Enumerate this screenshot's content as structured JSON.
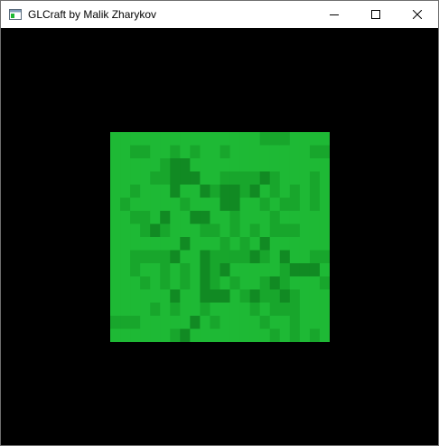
{
  "window": {
    "title": "GLCraft by Malik Zharykov",
    "app_icon": "application-window-icon",
    "controls": {
      "minimize": "minimize-icon",
      "maximize": "maximize-icon",
      "close": "close-icon"
    }
  },
  "scene": {
    "background_color": "#000000",
    "block": {
      "name": "grass block",
      "palette": {
        "0": "#1eb935",
        "1": "#18a62c",
        "2": "#118a23"
      },
      "grid": [
        "0000000000000001110000",
        "0011001010010000000011",
        "0000012200000000000000",
        "0000112220011112100010",
        "0010002002122120101010",
        "0100000100022001011010",
        "0011020022001000100000",
        "0001210001101010111000",
        "0000000200010102000000",
        "0011112002111121020011",
        "0010010102120000012220",
        "0001010102101001210001",
        "0000002002220121121000",
        "0000101001000010111000",
        "1110000020100001001000",
        "0000001200000000101010"
      ]
    }
  }
}
